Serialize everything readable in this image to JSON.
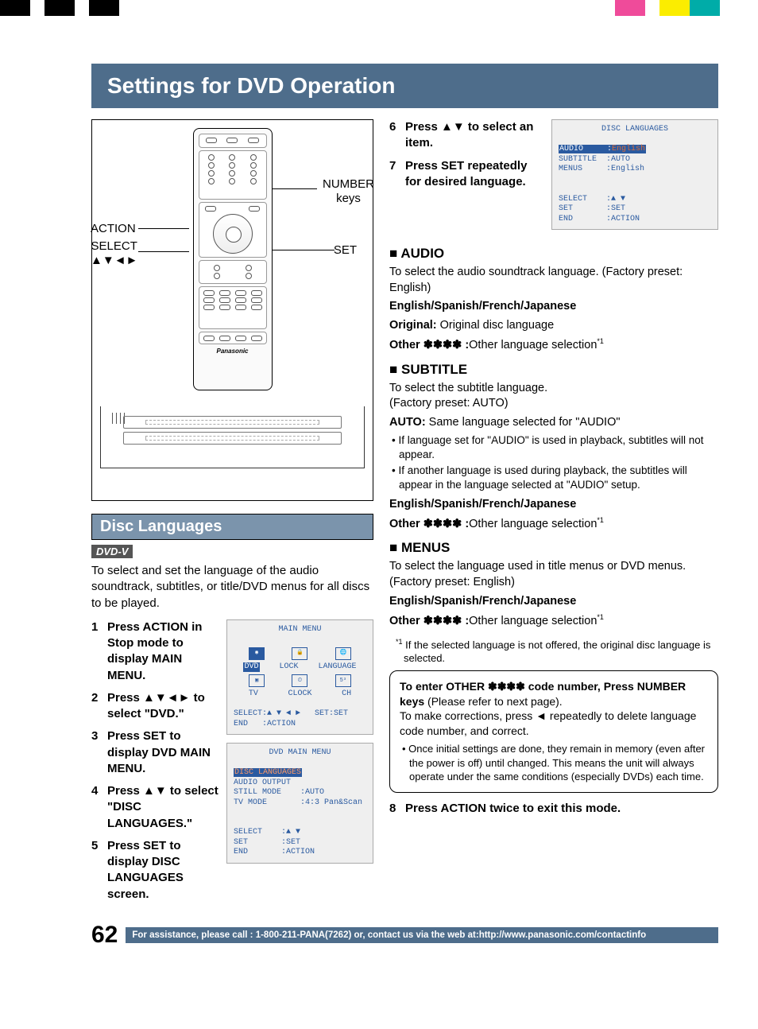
{
  "colorbar": [
    "#000",
    "#fff",
    "#000",
    "#fff",
    "#000",
    "#fff",
    "#fff",
    "#fff",
    "#fff",
    "#fff",
    "#fff",
    "#fff",
    "#fff",
    "#ef4b9a",
    "#fff",
    "#fbed00",
    "#00aca8",
    "#fff"
  ],
  "title": "Settings for DVD Operation",
  "remote": {
    "label_action": "ACTION",
    "label_select": "SELECT\n▲▼◄►",
    "label_number": "NUMBER\nkeys",
    "label_set": "SET",
    "brand": "Panasonic"
  },
  "section": {
    "heading": "Disc Languages",
    "badge": "DVD-V",
    "intro": "To select and set the language of the audio soundtrack, subtitles, or title/DVD menus for all discs to be played."
  },
  "steps_left": [
    {
      "n": "1",
      "t": "Press ACTION in Stop mode to display MAIN MENU."
    },
    {
      "n": "2",
      "t": "Press ▲▼◄► to select \"DVD.\""
    },
    {
      "n": "3",
      "t": "Press SET to display DVD MAIN MENU."
    },
    {
      "n": "4",
      "t": "Press ▲▼ to select \"DISC LANGUAGES.\""
    },
    {
      "n": "5",
      "t": "Press SET to display DISC LANGUAGES screen."
    }
  ],
  "osd_main": {
    "title": "MAIN MENU",
    "row1": [
      "DVD",
      "LOCK",
      "LANGUAGE"
    ],
    "row2": [
      "TV",
      "CLOCK",
      "CH"
    ],
    "footer": "SELECT:▲ ▼ ◄ ►   SET:SET\nEND   :ACTION"
  },
  "osd_dvd": {
    "title": "DVD MAIN MENU",
    "hl": "DISC LANGUAGES",
    "rows": "AUDIO OUTPUT\nSTILL MODE    :AUTO\nTV MODE       :4:3 Pan&Scan",
    "footer": "SELECT    :▲ ▼\nSET       :SET\nEND       :ACTION"
  },
  "osd_lang": {
    "title": "DISC LANGUAGES",
    "hl": "AUDIO     :English",
    "rows": "SUBTITLE  :AUTO\nMENUS     :English",
    "footer": "SELECT    :▲ ▼\nSET       :SET\nEND       :ACTION"
  },
  "steps_right": [
    {
      "n": "6",
      "t": "Press ▲▼ to select an item."
    },
    {
      "n": "7",
      "t": "Press SET repeatedly for desired language."
    }
  ],
  "audio": {
    "h": "AUDIO",
    "p1": "To select the audio soundtrack language. (Factory preset: English)",
    "p2": "English/Spanish/French/Japanese",
    "p3a": "Original:",
    "p3b": " Original disc language",
    "p4a": "Other ✽✽✽✽ :",
    "p4b": "Other language selection",
    "p4sup": "*1"
  },
  "subtitle": {
    "h": "SUBTITLE",
    "p1": "To select the subtitle language.\n(Factory preset: AUTO)",
    "p2a": "AUTO:",
    "p2b": " Same language selected for \"AUDIO\"",
    "b1": "If language set for \"AUDIO\" is used in playback, subtitles will not appear.",
    "b2": "If another language is used during playback, the subtitles will appear in the language selected at \"AUDIO\" setup.",
    "p3": "English/Spanish/French/Japanese",
    "p4a": "Other ✽✽✽✽ :",
    "p4b": "Other language selection",
    "p4sup": "*1"
  },
  "menus": {
    "h": "MENUS",
    "p1": "To select the language used in title menus or DVD menus. (Factory preset: English)",
    "p2": "English/Spanish/French/Japanese",
    "p3a": "Other ✽✽✽✽ :",
    "p3b": "Other language selection",
    "p3sup": "*1"
  },
  "footnote": "If the selected language is not offered, the original disc language is selected.",
  "footnote_sup": "*1",
  "callout": {
    "l1a": "To enter OTHER ✽✽✽✽ code number, Press NUMBER keys",
    "l1b": " (Please refer to next page).",
    "l2": "To make corrections, press ◄ repeatedly to delete language code number, and correct.",
    "b1": "Once initial settings are done, they remain in memory (even after the power is off) until changed. This means the unit will always operate under the same conditions (especially DVDs) each time."
  },
  "step8": {
    "n": "8",
    "t": "Press ACTION twice to exit this mode."
  },
  "footer": {
    "page": "62",
    "assist": "For assistance, please call : 1-800-211-PANA(7262) or, contact us via the web at:http://www.panasonic.com/contactinfo"
  }
}
